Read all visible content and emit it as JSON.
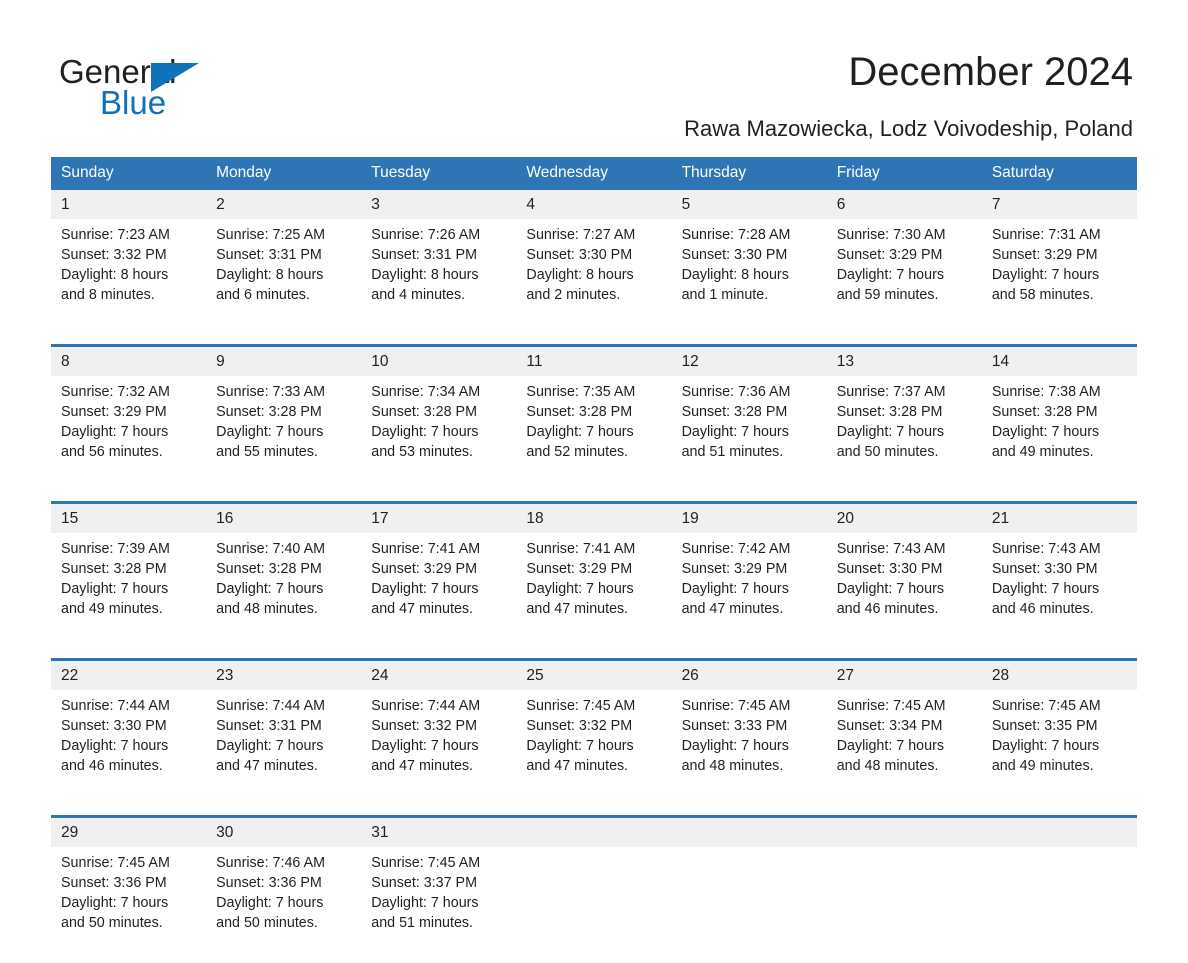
{
  "logo": {
    "word_top": "General",
    "word_bottom": "Blue",
    "triangle_icon": "triangle-icon",
    "color_black": "#231f20",
    "color_blue": "#1072b8"
  },
  "header": {
    "title": "December 2024",
    "subtitle": "Rawa Mazowiecka, Lodz Voivodeship, Poland"
  },
  "theme": {
    "header_blue": "#2e75b6",
    "daynum_gray": "#f0f0f0",
    "text": "#231f20"
  },
  "calendar": {
    "weekday_headers": [
      "Sunday",
      "Monday",
      "Tuesday",
      "Wednesday",
      "Thursday",
      "Friday",
      "Saturday"
    ],
    "weeks": [
      [
        {
          "day": "1",
          "sunrise": "Sunrise: 7:23 AM",
          "sunset": "Sunset: 3:32 PM",
          "daylight1": "Daylight: 8 hours",
          "daylight2": "and 8 minutes."
        },
        {
          "day": "2",
          "sunrise": "Sunrise: 7:25 AM",
          "sunset": "Sunset: 3:31 PM",
          "daylight1": "Daylight: 8 hours",
          "daylight2": "and 6 minutes."
        },
        {
          "day": "3",
          "sunrise": "Sunrise: 7:26 AM",
          "sunset": "Sunset: 3:31 PM",
          "daylight1": "Daylight: 8 hours",
          "daylight2": "and 4 minutes."
        },
        {
          "day": "4",
          "sunrise": "Sunrise: 7:27 AM",
          "sunset": "Sunset: 3:30 PM",
          "daylight1": "Daylight: 8 hours",
          "daylight2": "and 2 minutes."
        },
        {
          "day": "5",
          "sunrise": "Sunrise: 7:28 AM",
          "sunset": "Sunset: 3:30 PM",
          "daylight1": "Daylight: 8 hours",
          "daylight2": "and 1 minute."
        },
        {
          "day": "6",
          "sunrise": "Sunrise: 7:30 AM",
          "sunset": "Sunset: 3:29 PM",
          "daylight1": "Daylight: 7 hours",
          "daylight2": "and 59 minutes."
        },
        {
          "day": "7",
          "sunrise": "Sunrise: 7:31 AM",
          "sunset": "Sunset: 3:29 PM",
          "daylight1": "Daylight: 7 hours",
          "daylight2": "and 58 minutes."
        }
      ],
      [
        {
          "day": "8",
          "sunrise": "Sunrise: 7:32 AM",
          "sunset": "Sunset: 3:29 PM",
          "daylight1": "Daylight: 7 hours",
          "daylight2": "and 56 minutes."
        },
        {
          "day": "9",
          "sunrise": "Sunrise: 7:33 AM",
          "sunset": "Sunset: 3:28 PM",
          "daylight1": "Daylight: 7 hours",
          "daylight2": "and 55 minutes."
        },
        {
          "day": "10",
          "sunrise": "Sunrise: 7:34 AM",
          "sunset": "Sunset: 3:28 PM",
          "daylight1": "Daylight: 7 hours",
          "daylight2": "and 53 minutes."
        },
        {
          "day": "11",
          "sunrise": "Sunrise: 7:35 AM",
          "sunset": "Sunset: 3:28 PM",
          "daylight1": "Daylight: 7 hours",
          "daylight2": "and 52 minutes."
        },
        {
          "day": "12",
          "sunrise": "Sunrise: 7:36 AM",
          "sunset": "Sunset: 3:28 PM",
          "daylight1": "Daylight: 7 hours",
          "daylight2": "and 51 minutes."
        },
        {
          "day": "13",
          "sunrise": "Sunrise: 7:37 AM",
          "sunset": "Sunset: 3:28 PM",
          "daylight1": "Daylight: 7 hours",
          "daylight2": "and 50 minutes."
        },
        {
          "day": "14",
          "sunrise": "Sunrise: 7:38 AM",
          "sunset": "Sunset: 3:28 PM",
          "daylight1": "Daylight: 7 hours",
          "daylight2": "and 49 minutes."
        }
      ],
      [
        {
          "day": "15",
          "sunrise": "Sunrise: 7:39 AM",
          "sunset": "Sunset: 3:28 PM",
          "daylight1": "Daylight: 7 hours",
          "daylight2": "and 49 minutes."
        },
        {
          "day": "16",
          "sunrise": "Sunrise: 7:40 AM",
          "sunset": "Sunset: 3:28 PM",
          "daylight1": "Daylight: 7 hours",
          "daylight2": "and 48 minutes."
        },
        {
          "day": "17",
          "sunrise": "Sunrise: 7:41 AM",
          "sunset": "Sunset: 3:29 PM",
          "daylight1": "Daylight: 7 hours",
          "daylight2": "and 47 minutes."
        },
        {
          "day": "18",
          "sunrise": "Sunrise: 7:41 AM",
          "sunset": "Sunset: 3:29 PM",
          "daylight1": "Daylight: 7 hours",
          "daylight2": "and 47 minutes."
        },
        {
          "day": "19",
          "sunrise": "Sunrise: 7:42 AM",
          "sunset": "Sunset: 3:29 PM",
          "daylight1": "Daylight: 7 hours",
          "daylight2": "and 47 minutes."
        },
        {
          "day": "20",
          "sunrise": "Sunrise: 7:43 AM",
          "sunset": "Sunset: 3:30 PM",
          "daylight1": "Daylight: 7 hours",
          "daylight2": "and 46 minutes."
        },
        {
          "day": "21",
          "sunrise": "Sunrise: 7:43 AM",
          "sunset": "Sunset: 3:30 PM",
          "daylight1": "Daylight: 7 hours",
          "daylight2": "and 46 minutes."
        }
      ],
      [
        {
          "day": "22",
          "sunrise": "Sunrise: 7:44 AM",
          "sunset": "Sunset: 3:30 PM",
          "daylight1": "Daylight: 7 hours",
          "daylight2": "and 46 minutes."
        },
        {
          "day": "23",
          "sunrise": "Sunrise: 7:44 AM",
          "sunset": "Sunset: 3:31 PM",
          "daylight1": "Daylight: 7 hours",
          "daylight2": "and 47 minutes."
        },
        {
          "day": "24",
          "sunrise": "Sunrise: 7:44 AM",
          "sunset": "Sunset: 3:32 PM",
          "daylight1": "Daylight: 7 hours",
          "daylight2": "and 47 minutes."
        },
        {
          "day": "25",
          "sunrise": "Sunrise: 7:45 AM",
          "sunset": "Sunset: 3:32 PM",
          "daylight1": "Daylight: 7 hours",
          "daylight2": "and 47 minutes."
        },
        {
          "day": "26",
          "sunrise": "Sunrise: 7:45 AM",
          "sunset": "Sunset: 3:33 PM",
          "daylight1": "Daylight: 7 hours",
          "daylight2": "and 48 minutes."
        },
        {
          "day": "27",
          "sunrise": "Sunrise: 7:45 AM",
          "sunset": "Sunset: 3:34 PM",
          "daylight1": "Daylight: 7 hours",
          "daylight2": "and 48 minutes."
        },
        {
          "day": "28",
          "sunrise": "Sunrise: 7:45 AM",
          "sunset": "Sunset: 3:35 PM",
          "daylight1": "Daylight: 7 hours",
          "daylight2": "and 49 minutes."
        }
      ],
      [
        {
          "day": "29",
          "sunrise": "Sunrise: 7:45 AM",
          "sunset": "Sunset: 3:36 PM",
          "daylight1": "Daylight: 7 hours",
          "daylight2": "and 50 minutes."
        },
        {
          "day": "30",
          "sunrise": "Sunrise: 7:46 AM",
          "sunset": "Sunset: 3:36 PM",
          "daylight1": "Daylight: 7 hours",
          "daylight2": "and 50 minutes."
        },
        {
          "day": "31",
          "sunrise": "Sunrise: 7:45 AM",
          "sunset": "Sunset: 3:37 PM",
          "daylight1": "Daylight: 7 hours",
          "daylight2": "and 51 minutes."
        },
        {
          "day": "",
          "sunrise": "",
          "sunset": "",
          "daylight1": "",
          "daylight2": ""
        },
        {
          "day": "",
          "sunrise": "",
          "sunset": "",
          "daylight1": "",
          "daylight2": ""
        },
        {
          "day": "",
          "sunrise": "",
          "sunset": "",
          "daylight1": "",
          "daylight2": ""
        },
        {
          "day": "",
          "sunrise": "",
          "sunset": "",
          "daylight1": "",
          "daylight2": ""
        }
      ]
    ]
  }
}
